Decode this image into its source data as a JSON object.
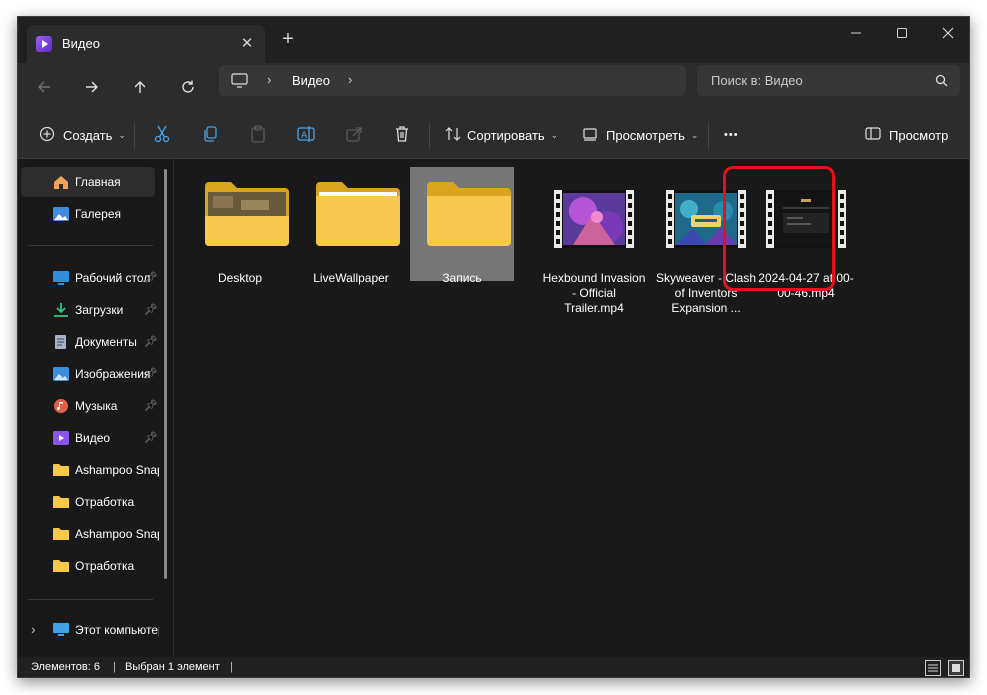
{
  "tab": {
    "title": "Видео"
  },
  "nav": {
    "breadcrumb": [
      "Видео"
    ]
  },
  "search": {
    "placeholder": "Поиск в: Видео"
  },
  "toolbar": {
    "create_label": "Создать",
    "sort_label": "Сортировать",
    "view_label": "Просмотреть",
    "more_label": "•••",
    "preview_label": "Просмотр"
  },
  "sidebar": {
    "items": [
      {
        "label": "Главная",
        "icon": "home-icon"
      },
      {
        "label": "Галерея",
        "icon": "gallery-icon"
      },
      {
        "label": "Рабочий стол",
        "icon": "desktop-icon",
        "pinned": true
      },
      {
        "label": "Загрузки",
        "icon": "download-icon",
        "pinned": true
      },
      {
        "label": "Документы",
        "icon": "documents-icon",
        "pinned": true
      },
      {
        "label": "Изображения",
        "icon": "pictures-icon",
        "pinned": true
      },
      {
        "label": "Музыка",
        "icon": "music-icon",
        "pinned": true
      },
      {
        "label": "Видео",
        "icon": "videos-icon",
        "pinned": true
      },
      {
        "label": "Ashampoo Snap",
        "icon": "folder-icon"
      },
      {
        "label": "Отработка",
        "icon": "folder-icon"
      },
      {
        "label": "Ashampoo Snap",
        "icon": "folder-icon"
      },
      {
        "label": "Отработка",
        "icon": "folder-icon"
      },
      {
        "label": "Этот компьютер",
        "icon": "computer-icon"
      }
    ]
  },
  "files": [
    {
      "name": "Desktop",
      "type": "folder"
    },
    {
      "name": "LiveWallpaper",
      "type": "folder"
    },
    {
      "name": "Запись",
      "type": "folder",
      "selected": true
    },
    {
      "name": "Hexbound Invasion - Official Trailer.mp4",
      "type": "video"
    },
    {
      "name": "Skyweaver - Clash of Inventors Expansion ...",
      "type": "video"
    },
    {
      "name": "2024-04-27 at 00-00-46.mp4",
      "type": "video",
      "highlighted": true
    }
  ],
  "status": {
    "count": "Элементов: 6",
    "selected": "Выбран 1 элемент"
  }
}
